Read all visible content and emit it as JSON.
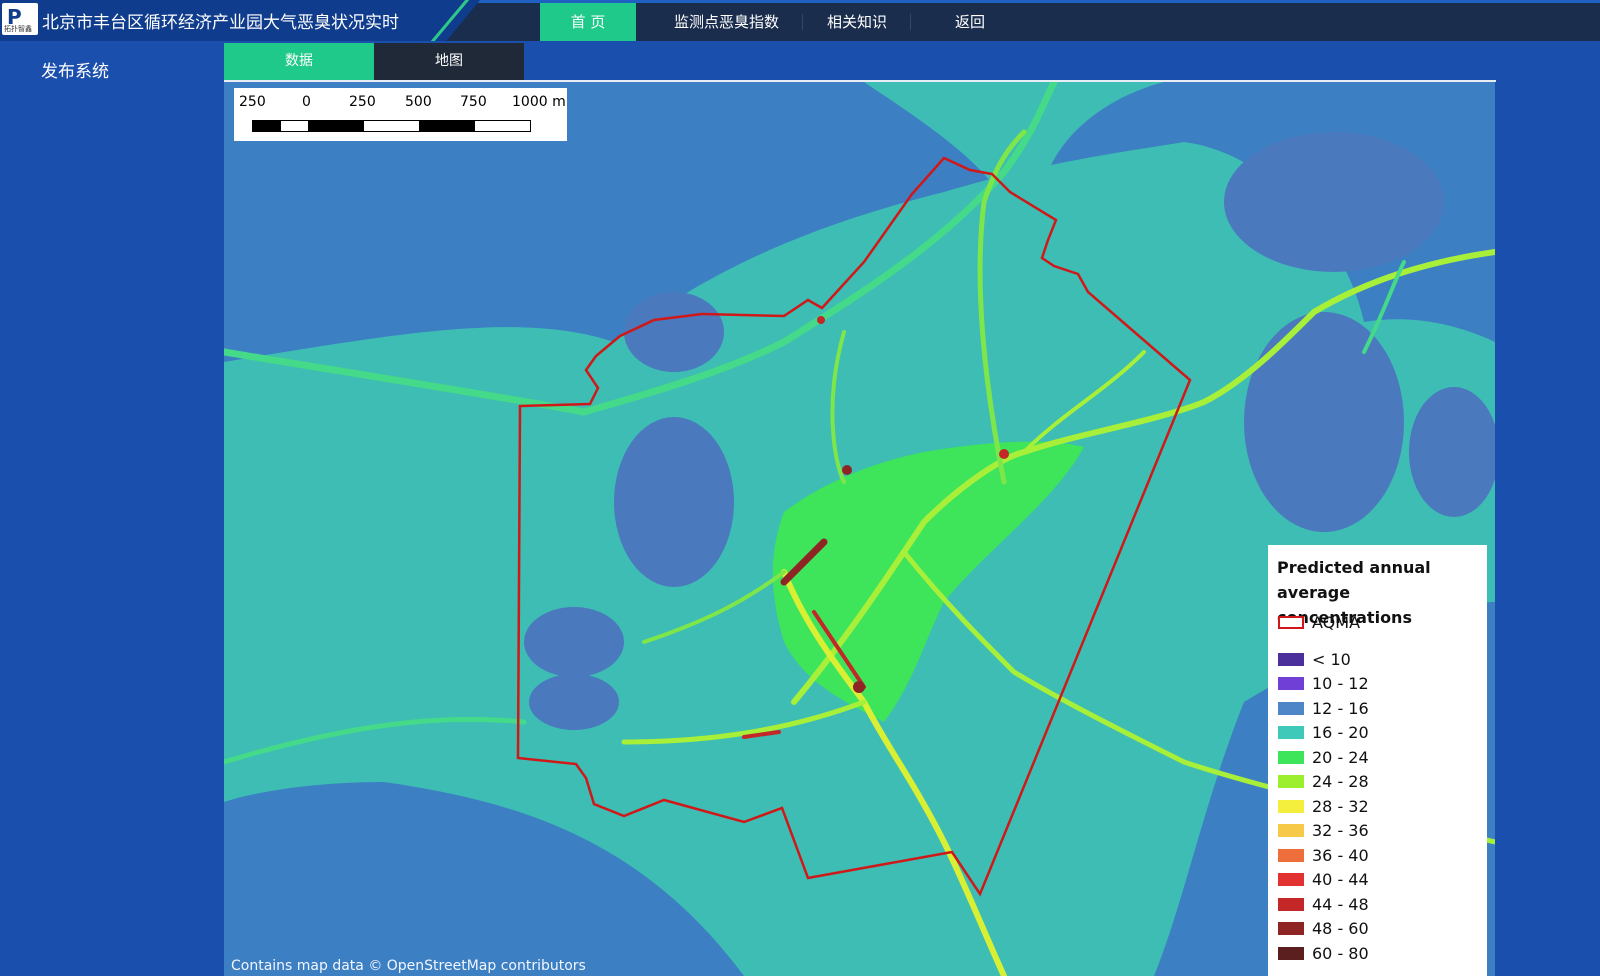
{
  "header": {
    "logo_mark": "P",
    "logo_text": "拓扑智鑫",
    "title": "北京市丰台区循环经济产业园大气恶臭状况实时",
    "nav": [
      {
        "label": "首 页",
        "active": true
      },
      {
        "label": "监测点恶臭指数",
        "active": false
      },
      {
        "label": "相关知识",
        "active": false
      },
      {
        "label": "返回",
        "active": false
      }
    ]
  },
  "sidebar": {
    "label": "发布系统"
  },
  "tabs": [
    {
      "label": "数据",
      "active": true
    },
    {
      "label": "地图",
      "active": false
    }
  ],
  "map": {
    "scale_labels": [
      "250",
      "0",
      "250",
      "500",
      "750",
      "1000 m"
    ],
    "attribution": "Contains map data © OpenStreetMap contributors",
    "legend": {
      "title": "Predicted annual average concentrations",
      "aqma_label": "AQMA",
      "aqma_color": "#d01818",
      "classes": [
        {
          "label": "< 10",
          "color": "#4b2f9b"
        },
        {
          "label": "10 - 12",
          "color": "#6f3fd6"
        },
        {
          "label": "12 - 16",
          "color": "#4f86c8"
        },
        {
          "label": "16 - 20",
          "color": "#3fc9b9"
        },
        {
          "label": "20 - 24",
          "color": "#3ee45a"
        },
        {
          "label": "24 - 28",
          "color": "#9cef2e"
        },
        {
          "label": "28 - 32",
          "color": "#f4ee3c"
        },
        {
          "label": "32 - 36",
          "color": "#f7c948"
        },
        {
          "label": "36 - 40",
          "color": "#ee6e3c"
        },
        {
          "label": "40 - 44",
          "color": "#e23131"
        },
        {
          "label": "44 - 48",
          "color": "#c42727"
        },
        {
          "label": "48 - 60",
          "color": "#8f2424"
        },
        {
          "label": "60 - 80",
          "color": "#5b1f1f"
        }
      ]
    }
  }
}
